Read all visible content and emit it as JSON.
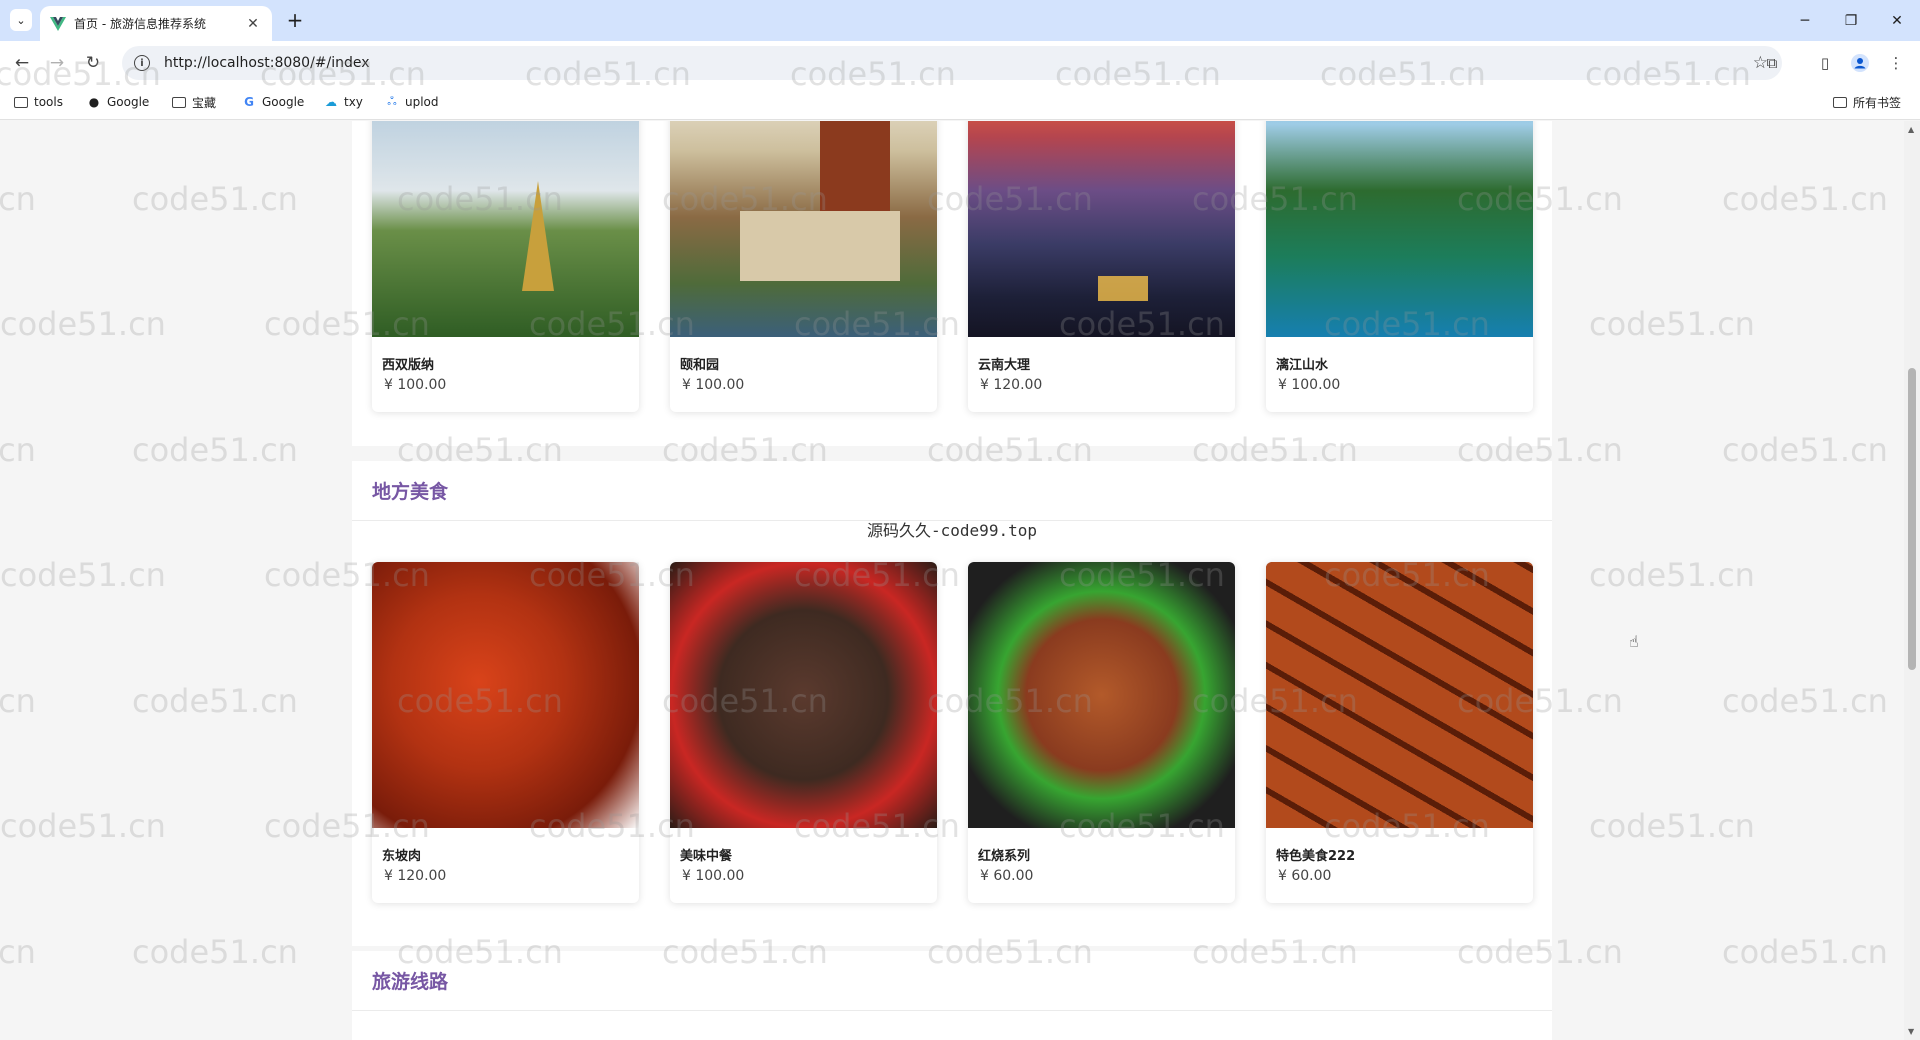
{
  "browser": {
    "tab_title": "首页 - 旅游信息推荐系统",
    "url": "http://localhost:8080/#/index",
    "bookmarks": [
      {
        "label": "tools",
        "icon": "folder-icon"
      },
      {
        "label": "Google",
        "icon": "github-icon"
      },
      {
        "label": "宝藏",
        "icon": "folder-icon"
      },
      {
        "label": "Google",
        "icon": "google-icon"
      },
      {
        "label": "txy",
        "icon": "cloud-icon"
      },
      {
        "label": "uplod",
        "icon": "people-icon"
      }
    ],
    "all_bookmarks": "所有书签"
  },
  "sections": {
    "attractions": {
      "items": [
        {
          "name": "西双版纳",
          "price": "¥ 100.00"
        },
        {
          "name": "颐和园",
          "price": "¥ 100.00"
        },
        {
          "name": "云南大理",
          "price": "¥ 120.00"
        },
        {
          "name": "漓江山水",
          "price": "¥ 100.00"
        }
      ]
    },
    "food": {
      "title": "地方美食",
      "items": [
        {
          "name": "东坡肉",
          "price": "¥ 120.00"
        },
        {
          "name": "美味中餐",
          "price": "¥ 100.00"
        },
        {
          "name": "红烧系列",
          "price": "¥ 60.00"
        },
        {
          "name": "特色美食222",
          "price": "¥ 60.00"
        }
      ]
    },
    "routes": {
      "title": "旅游线路"
    }
  },
  "overlay_note": "源码久久-code99.top",
  "watermark": "code51.cn"
}
